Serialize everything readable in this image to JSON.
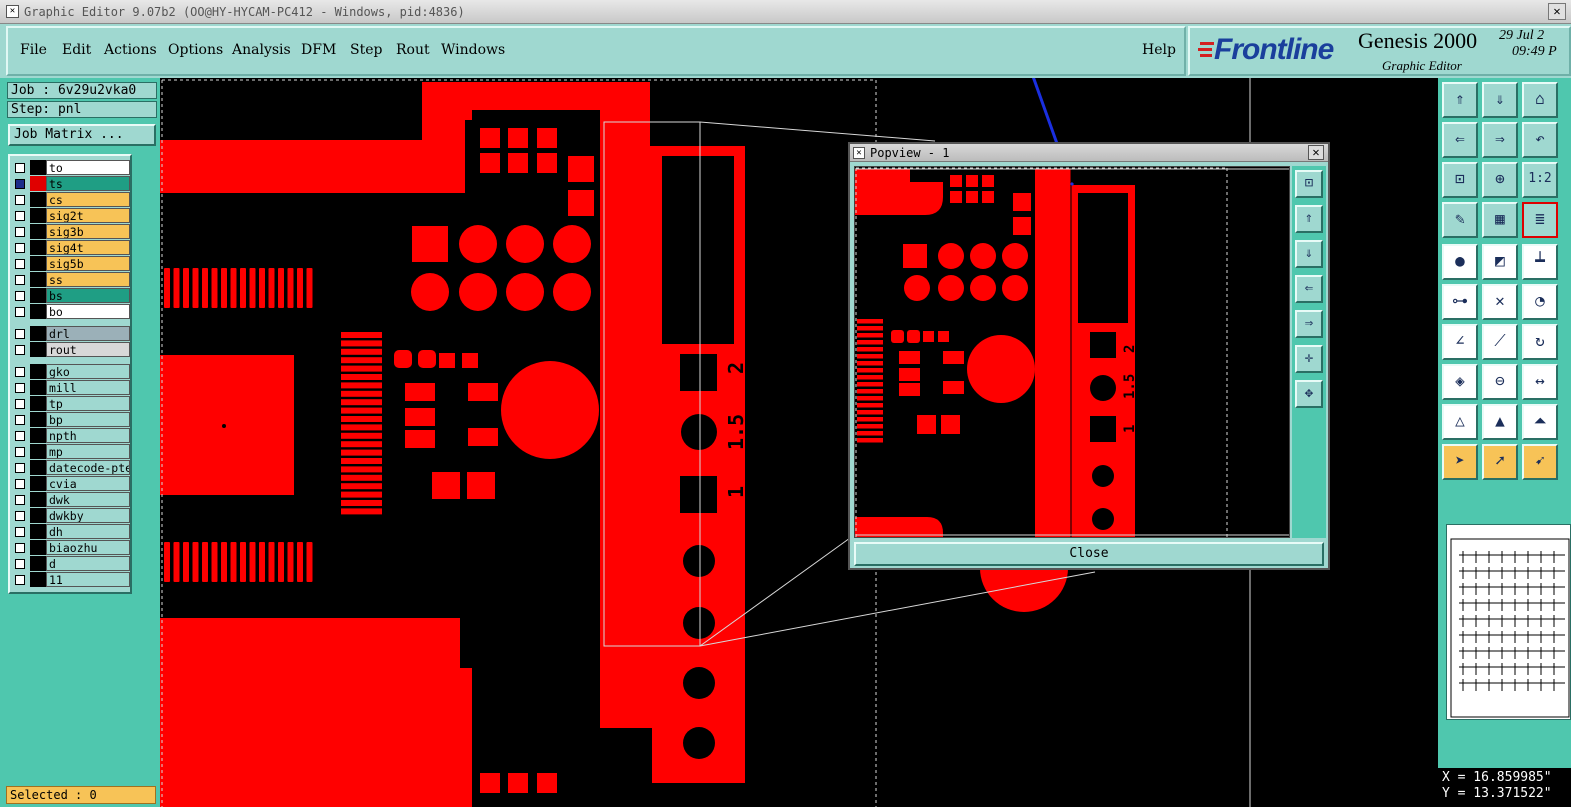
{
  "window": {
    "title": "Graphic Editor 9.07b2 (OO@HY-HYCAM-PC412 - Windows, pid:4836)",
    "close_glyph": "✕"
  },
  "menu": {
    "items": [
      "File",
      "Edit",
      "Actions",
      "Options",
      "Analysis",
      "DFM",
      "Step",
      "Rout",
      "Windows"
    ],
    "help": "Help"
  },
  "brand": {
    "logo": "Frontline",
    "product": "Genesis 2000",
    "subtitle": "Graphic Editor",
    "date": "29 Jul 2",
    "time": "09:49 P"
  },
  "job": {
    "job_label": "Job : 6v29u2vka0",
    "step_label": "Step: pnl",
    "matrix_button": "Job Matrix ..."
  },
  "layers": [
    {
      "name": "to",
      "color": "#ffffff",
      "swatch": "#000000",
      "checked": false
    },
    {
      "name": "ts",
      "color": "#1f9e84",
      "swatch": "#e00000",
      "checked": true
    },
    {
      "name": "cs",
      "color": "#f7c357",
      "swatch": "#000000",
      "checked": false
    },
    {
      "name": "sig2t",
      "color": "#f7c357",
      "swatch": "#000000",
      "checked": false
    },
    {
      "name": "sig3b",
      "color": "#f7c357",
      "swatch": "#000000",
      "checked": false
    },
    {
      "name": "sig4t",
      "color": "#f7c357",
      "swatch": "#000000",
      "checked": false
    },
    {
      "name": "sig5b",
      "color": "#f7c357",
      "swatch": "#000000",
      "checked": false
    },
    {
      "name": "ss",
      "color": "#f7c357",
      "swatch": "#000000",
      "checked": false
    },
    {
      "name": "bs",
      "color": "#1f9e84",
      "swatch": "#000000",
      "checked": false
    },
    {
      "name": "bo",
      "color": "#ffffff",
      "swatch": "#000000",
      "checked": false
    },
    {
      "name": "drl",
      "color": "#9bb0b8",
      "swatch": "#000000",
      "checked": false
    },
    {
      "name": "rout",
      "color": "#d8d8d8",
      "swatch": "#000000",
      "checked": false
    },
    {
      "name": "gko",
      "color": "#9fd8d0",
      "swatch": "#000000",
      "checked": false
    },
    {
      "name": "mill",
      "color": "#9fd8d0",
      "swatch": "#000000",
      "checked": false
    },
    {
      "name": "tp",
      "color": "#9fd8d0",
      "swatch": "#000000",
      "checked": false
    },
    {
      "name": "bp",
      "color": "#9fd8d0",
      "swatch": "#000000",
      "checked": false
    },
    {
      "name": "npth",
      "color": "#9fd8d0",
      "swatch": "#000000",
      "checked": false
    },
    {
      "name": "mp",
      "color": "#9fd8d0",
      "swatch": "#000000",
      "checked": false
    },
    {
      "name": "datecode-pte",
      "color": "#9fd8d0",
      "swatch": "#000000",
      "checked": false
    },
    {
      "name": "cvia",
      "color": "#9fd8d0",
      "swatch": "#000000",
      "checked": false
    },
    {
      "name": "dwk",
      "color": "#9fd8d0",
      "swatch": "#000000",
      "checked": false
    },
    {
      "name": "dwkby",
      "color": "#9fd8d0",
      "swatch": "#000000",
      "checked": false
    },
    {
      "name": "dh",
      "color": "#9fd8d0",
      "swatch": "#000000",
      "checked": false
    },
    {
      "name": "biaozhu",
      "color": "#9fd8d0",
      "swatch": "#000000",
      "checked": false
    },
    {
      "name": "d",
      "color": "#9fd8d0",
      "swatch": "#000000",
      "checked": false
    },
    {
      "name": "11",
      "color": "#9fd8d0",
      "swatch": "#000000",
      "checked": false
    }
  ],
  "status": {
    "selected": "Selected : 0",
    "x": "X = 16.859985\"",
    "y": "Y = 13.371522\""
  },
  "popview": {
    "title": "Popview - 1",
    "close_button": "Close",
    "tool_icons": [
      "zoom-fit-icon",
      "pan-up-icon",
      "pan-down-icon",
      "pan-left-icon",
      "pan-right-icon",
      "zoom-in-icon",
      "zoom-out-icon"
    ]
  },
  "pcb_marks": {
    "main_labels": [
      "2",
      "1.5",
      "1"
    ],
    "popup_labels": [
      "2",
      "1.5",
      "1"
    ]
  },
  "colors": {
    "copper": "#ff0000",
    "background": "#000000",
    "panel": "#9fd8d0",
    "panel_dark": "#4fc7ae",
    "arrow": "#1a2fe0"
  },
  "right_tools": [
    "pan-up-icon",
    "pan-down-icon",
    "home-icon",
    "pan-left-icon",
    "pan-right-icon",
    "undo-zoom-icon",
    "zoom-fit-icon",
    "zoom-center-icon",
    "zoom-1to2-icon",
    "snap-icon",
    "grid-icon",
    "layer-stack-icon",
    "measure-point-icon",
    "measure-box-icon",
    "ruler-icon",
    "connect-nodes-icon",
    "cross-select-icon",
    "measure-arc-icon",
    "line-angle-icon",
    "line-select-icon",
    "rotate-icon",
    "snap-pad-icon",
    "line-center-icon",
    "dimension-icon",
    "triangle-select-icon",
    "triangle-select2-icon",
    "triangle-select3-icon",
    "pointer-icon",
    "pointer-box-icon",
    "pointer-edit-icon"
  ]
}
